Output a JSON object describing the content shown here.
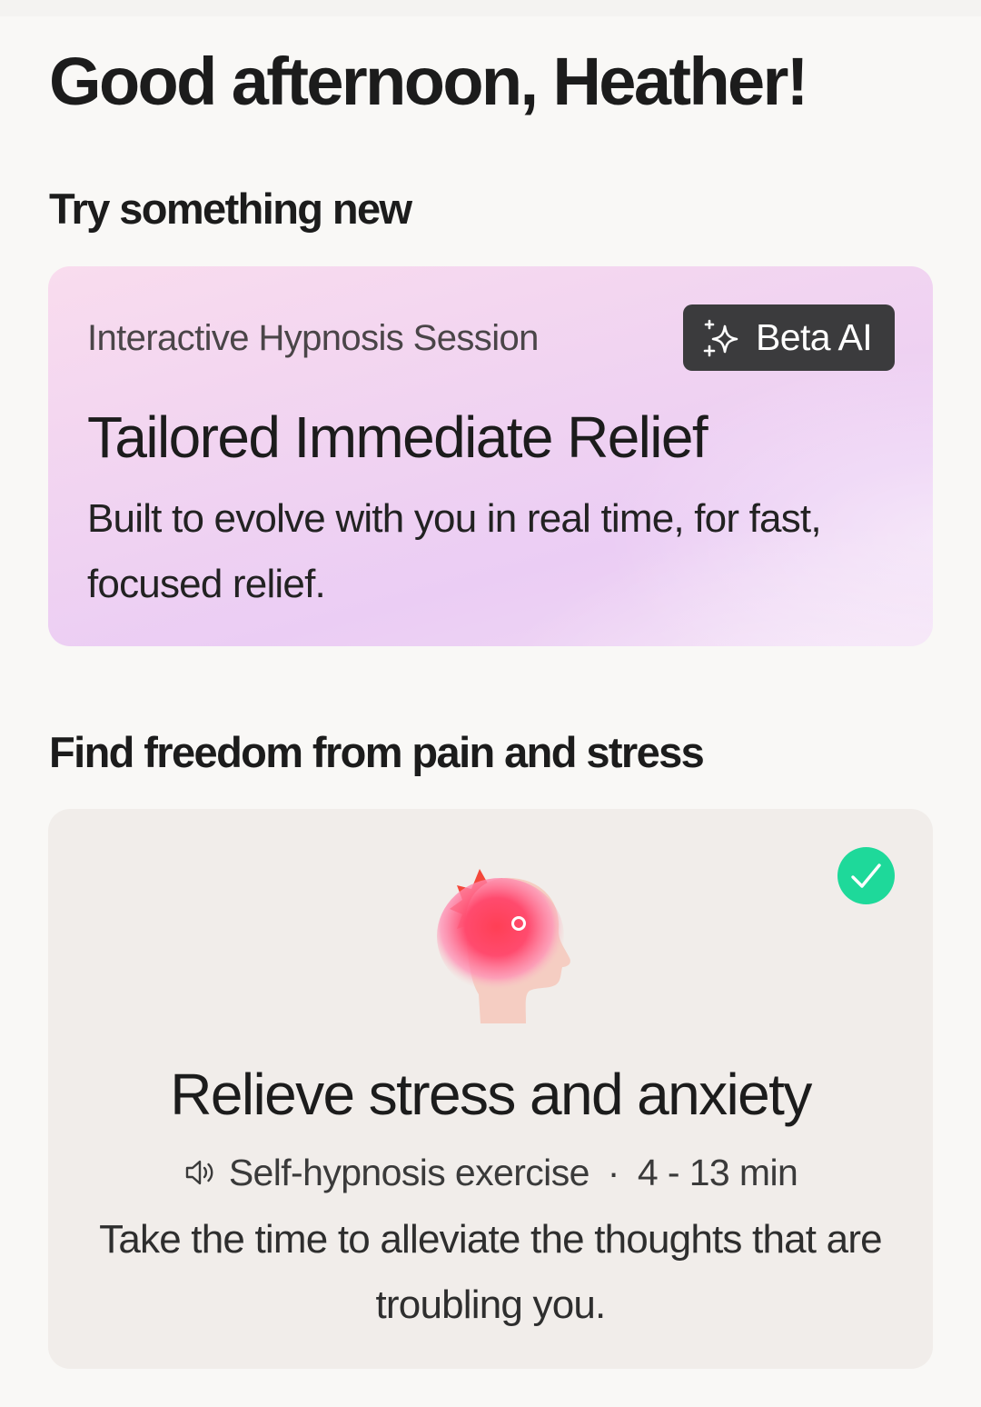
{
  "greeting": "Good afternoon, Heather!",
  "sections": {
    "try_new": {
      "title": "Try something new",
      "card": {
        "label": "Interactive Hypnosis Session",
        "badge": {
          "icon": "sparkle-icon",
          "label": "Beta AI"
        },
        "title": "Tailored Immediate Relief",
        "description": "Built to evolve with you in real time, for fast, focused relief."
      }
    },
    "freedom": {
      "title": "Find freedom from pain and stress",
      "card": {
        "illustration": "head-stress-icon",
        "completed": true,
        "title": "Relieve stress and anxiety",
        "meta": {
          "icon": "speaker-icon",
          "type": "Self-hypnosis exercise",
          "separator": "·",
          "duration": "4 - 13 min"
        },
        "description": "Take the time to alleviate the thoughts that are troubling you."
      }
    }
  },
  "colors": {
    "background": "#f9f8f6",
    "badge": "#3b3b3d",
    "check": "#1ed99a",
    "promo_card": "#ebcdf4",
    "program_card": "#f1edea"
  }
}
